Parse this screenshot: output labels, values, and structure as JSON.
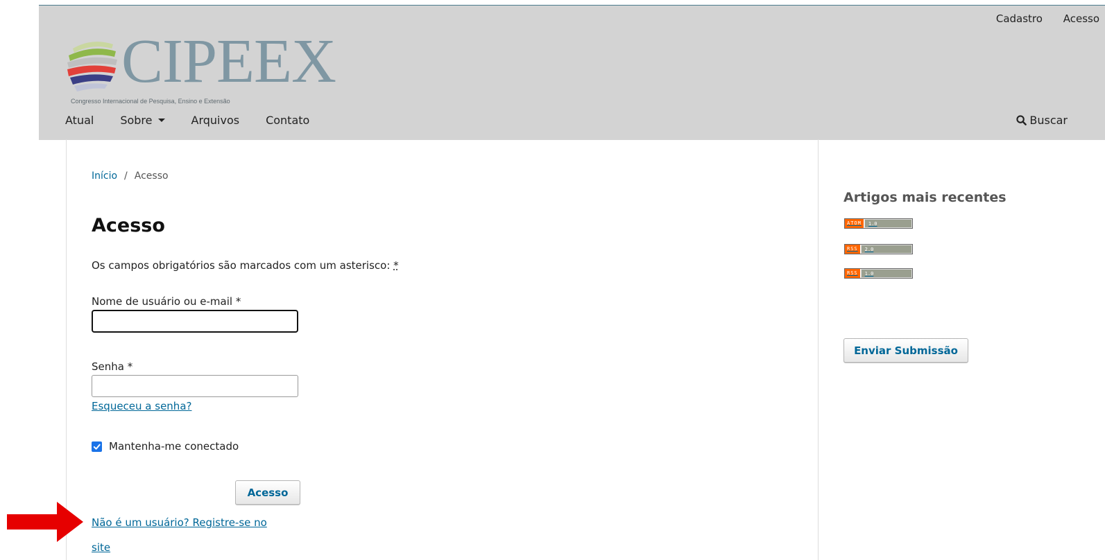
{
  "header": {
    "user_nav": {
      "register": "Cadastro",
      "login": "Acesso"
    },
    "logo": {
      "text": "CIPEEX",
      "tagline": "Congresso Internacional de Pesquisa, Ensino e Extensão"
    },
    "nav": {
      "current": "Atual",
      "about": "Sobre",
      "archives": "Arquivos",
      "contact": "Contato"
    },
    "search": "Buscar"
  },
  "breadcrumb": {
    "home": "Início",
    "separator": "/",
    "current": "Acesso"
  },
  "page_title": "Acesso",
  "required_note": {
    "text": "Os campos obrigatórios são marcados com um asterisco: ",
    "mark": "*"
  },
  "form": {
    "username_label": "Nome de usuário ou e-mail *",
    "username_value": "",
    "password_label": "Senha *",
    "password_value": "",
    "forgot_link": "Esqueceu a senha?",
    "remember_label": "Mantenha-me conectado",
    "remember_checked": true,
    "submit": "Acesso",
    "register_text": "Não é um usuário? Registre-se no site"
  },
  "sidebar": {
    "title": "Artigos mais recentes",
    "feeds": [
      {
        "type": "ATOM",
        "version": "1.0"
      },
      {
        "type": "RSS",
        "version": "2.0"
      },
      {
        "type": "RSS",
        "version": "1.0"
      }
    ],
    "submit_button": "Enviar Submissão"
  },
  "colors": {
    "link": "#006798",
    "header_bg": "#d3d3d3",
    "annotation_arrow": "#e60000",
    "feed_orange": "#ff6600"
  }
}
